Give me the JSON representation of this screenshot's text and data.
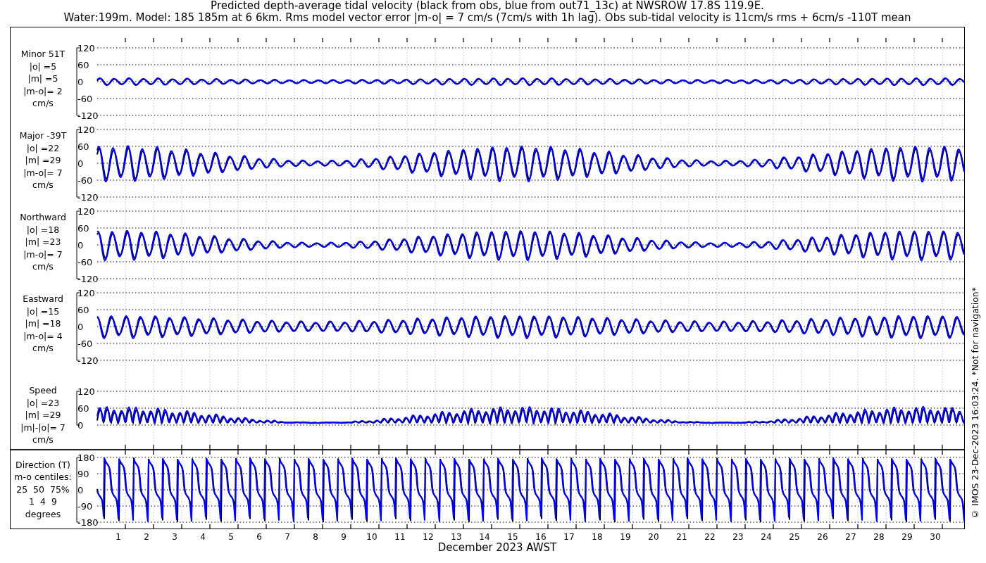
{
  "title": [
    "Predicted depth-average tidal velocity (black from obs, blue from out71_13c) at NWSROW 17.8S 119.9E.",
    "Water:199m. Model: 185 185m at 6 6km. Rms model vector error |m-o| = 7 cm/s (7cm/s with 1h lag). Obs sub-tidal velocity is 11cm/s rms + 6cm/s -110T mean"
  ],
  "panels": [
    {
      "kind": "component",
      "label": [
        "Minor 51T",
        "|o| =5",
        "|m| =5",
        "|m-o|= 2",
        "cm/s"
      ],
      "yticks": [
        "120",
        "60",
        "0",
        "-60",
        "-120"
      ]
    },
    {
      "kind": "component",
      "label": [
        "Major -39T",
        "|o| =22",
        "|m| =29",
        "|m-o|= 7",
        "cm/s"
      ],
      "yticks": [
        "120",
        "60",
        "0",
        "-60",
        "-120"
      ]
    },
    {
      "kind": "component",
      "label": [
        "Northward",
        "|o| =18",
        "|m| =23",
        "|m-o|= 7",
        "cm/s"
      ],
      "yticks": [
        "120",
        "60",
        "0",
        "-60",
        "-120"
      ]
    },
    {
      "kind": "component",
      "label": [
        "Eastward",
        "|o| =15",
        "|m| =18",
        "|m-o|= 4",
        "cm/s"
      ],
      "yticks": [
        "120",
        "60",
        "0",
        "-60",
        "-120"
      ]
    },
    {
      "kind": "speed",
      "label": [
        "Speed",
        "|o| =23",
        "|m| =29",
        "|m|-|o|= 7",
        "cm/s"
      ],
      "yticks": [
        "120",
        "60",
        "0"
      ]
    },
    {
      "kind": "direction",
      "label": [
        "Direction (T)",
        "m-o centiles:",
        "25  50  75%",
        "1  4  9",
        "degrees"
      ],
      "yticks": [
        "180",
        "90",
        "0",
        "-90",
        "-180"
      ]
    }
  ],
  "x_axis": {
    "day_labels": [
      "1",
      "2",
      "3",
      "4",
      "5",
      "6",
      "7",
      "8",
      "9",
      "10",
      "11",
      "12",
      "13",
      "14",
      "15",
      "16",
      "17",
      "18",
      "19",
      "20",
      "21",
      "22",
      "23",
      "24",
      "25",
      "26",
      "27",
      "28",
      "29",
      "30"
    ],
    "title": "December 2023 AWST"
  },
  "footer": "© IMOS 23-Dec-2023 16:03:24. *Not for navigation*"
}
